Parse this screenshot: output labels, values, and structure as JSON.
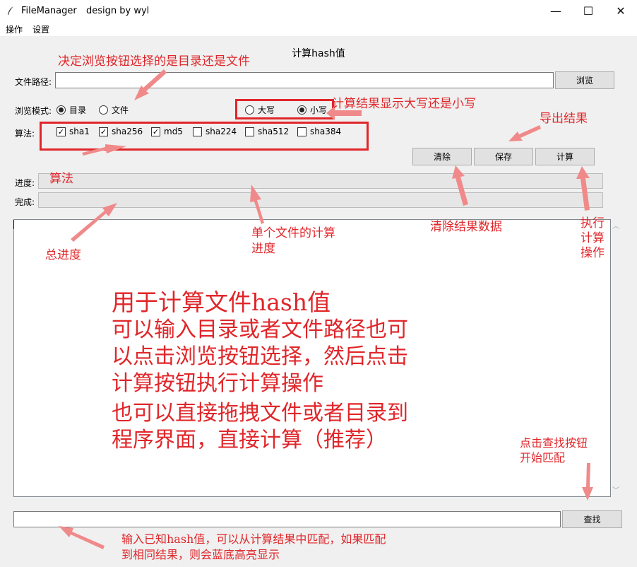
{
  "window": {
    "app_name": "FileManager",
    "subtitle": "design by wyl",
    "minimize_glyph": "—",
    "maximize_glyph": "☐",
    "close_glyph": "✕"
  },
  "menu": {
    "items": [
      "操作",
      "设置"
    ]
  },
  "main": {
    "title": "计算hash值",
    "path_label": "文件路径:",
    "path_value": "",
    "browse_button": "浏览",
    "browse_mode_label": "浏览模式:",
    "browse_modes": [
      {
        "label": "目录",
        "selected": true
      },
      {
        "label": "文件",
        "selected": false
      }
    ],
    "case_options": [
      {
        "label": "大写",
        "selected": false
      },
      {
        "label": "小写",
        "selected": true
      }
    ],
    "algo_label": "算法:",
    "algorithms": [
      {
        "label": "sha1",
        "checked": true
      },
      {
        "label": "sha256",
        "checked": true
      },
      {
        "label": "md5",
        "checked": true
      },
      {
        "label": "sha224",
        "checked": false
      },
      {
        "label": "sha512",
        "checked": false
      },
      {
        "label": "sha384",
        "checked": false
      }
    ],
    "clear_button": "清除",
    "save_button": "保存",
    "compute_button": "计算",
    "progress_label": "进度:",
    "progress_value": 0,
    "complete_label": "完成:",
    "complete_value": 0,
    "result_text": "",
    "search_value": "",
    "search_button": "查找"
  },
  "annotations": {
    "browse_hint": "决定浏览按钮选择的是目录还是文件",
    "case_hint": "计算结果显示大写还是小写",
    "export_hint": "导出结果",
    "algo_hint": "算法",
    "clear_hint": "清除结果数据",
    "compute_hint": [
      "执行",
      "计算",
      "操作"
    ],
    "total_progress_hint": "总进度",
    "file_progress_hint": [
      "单个文件的计算",
      "进度"
    ],
    "main_description": [
      "用于计算文件hash值",
      "可以输入目录或者文件路径也可",
      "以点击浏览按钮选择，然后点击",
      "计算按钮执行计算操作",
      "也可以直接拖拽文件或者目录到",
      "程序界面，直接计算（推荐）"
    ],
    "search_hint": [
      "点击查找按钮",
      "开始匹配"
    ],
    "match_hint": [
      "输入已知hash值，可以从计算结果中匹配，如果匹配",
      "到相同结果，则会蓝底高亮显示"
    ]
  },
  "colors": {
    "annotation_red": "#e0262a",
    "arrow_fill": "#f08a8a",
    "window_bg": "#f0f0f0",
    "button_bg": "#e1e1e1"
  }
}
